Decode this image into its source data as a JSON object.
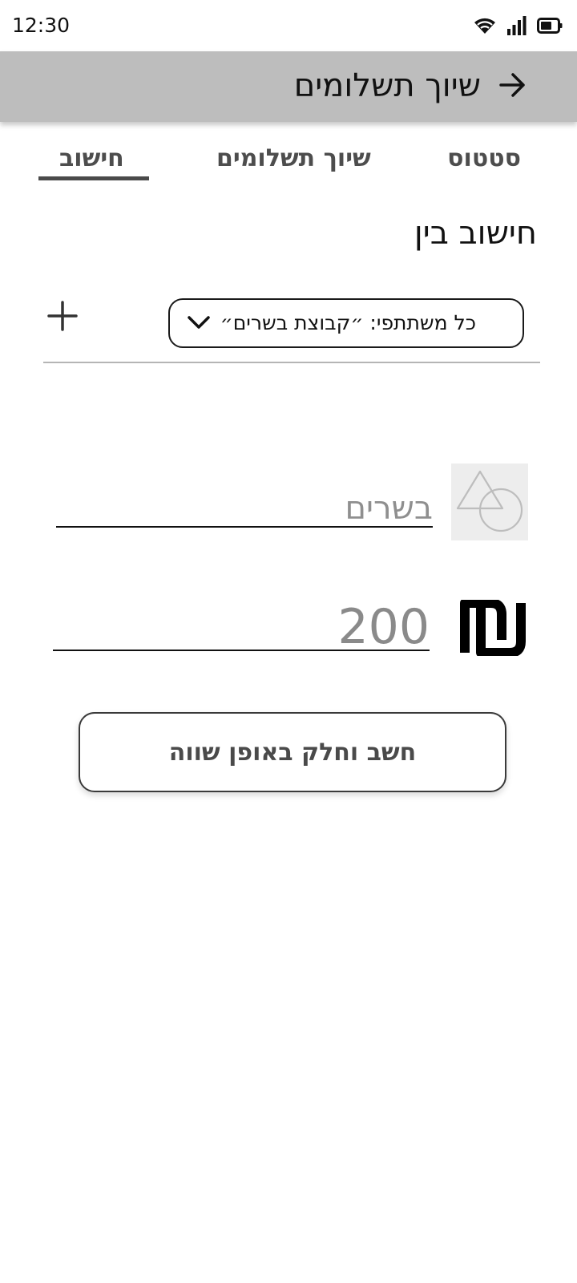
{
  "status_bar": {
    "time": "12:30",
    "icons": [
      "wifi-icon",
      "cellular-signal-icon",
      "battery-icon"
    ]
  },
  "app_bar": {
    "title": "שיוך תשלומים",
    "back_icon": "arrow-right-icon",
    "background": "#bdbdbd"
  },
  "tabs": [
    {
      "label": "סטטוס",
      "active": false
    },
    {
      "label": "שיוך תשלומים",
      "active": false
    },
    {
      "label": "חישוב",
      "active": true
    }
  ],
  "section": {
    "title": "חישוב בין"
  },
  "participants": {
    "selected": "כל משתתפי: ״קבוצת בשרים״",
    "dropdown_icon": "chevron-down-icon",
    "add_icon": "plus-icon"
  },
  "form": {
    "category": {
      "value": "בשרים",
      "image_icon": "image-placeholder-icon"
    },
    "amount": {
      "value": "200",
      "currency_icon": "shekel-icon"
    }
  },
  "action": {
    "label": "חשב וחלק באופן שווה"
  }
}
